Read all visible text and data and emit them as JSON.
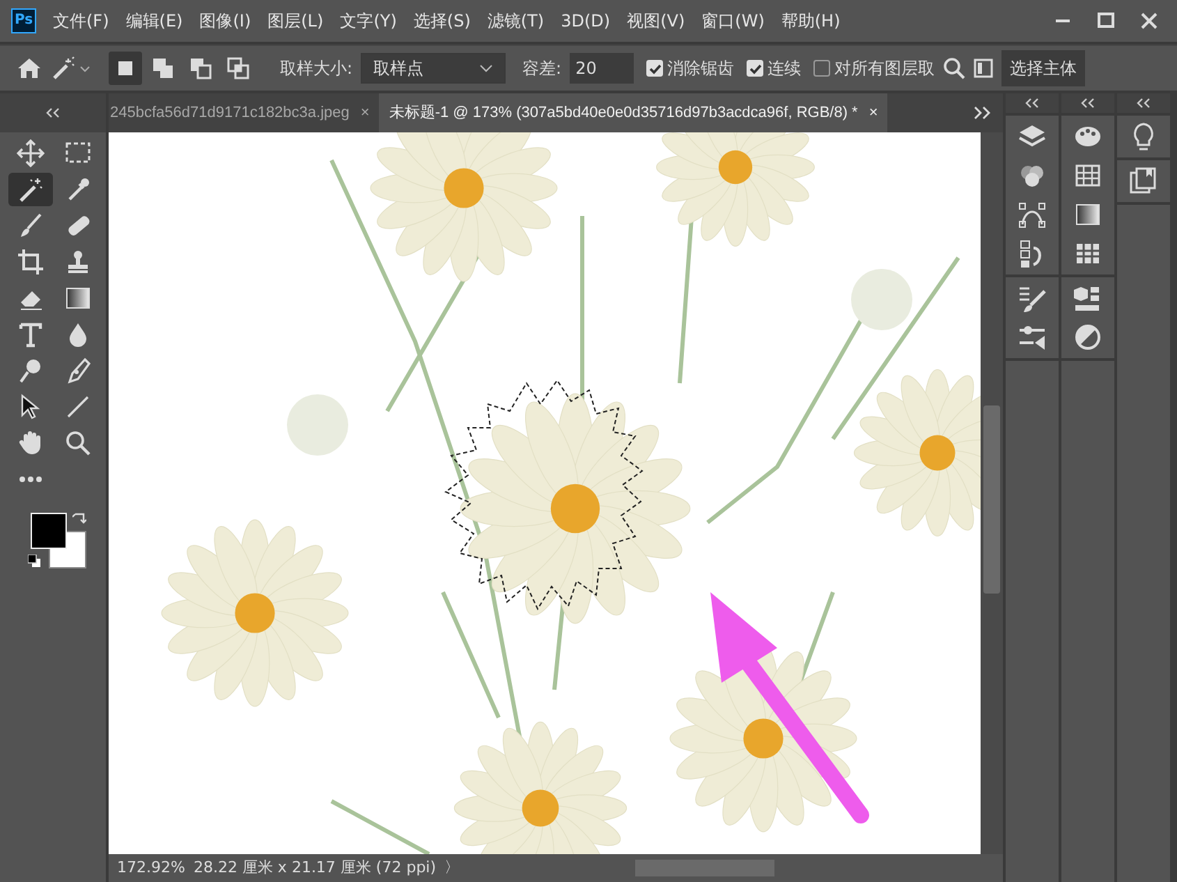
{
  "app_icon": "Ps",
  "menu": [
    "文件(F)",
    "编辑(E)",
    "图像(I)",
    "图层(L)",
    "文字(Y)",
    "选择(S)",
    "滤镜(T)",
    "3D(D)",
    "视图(V)",
    "窗口(W)",
    "帮助(H)"
  ],
  "options_bar": {
    "modes": [
      {
        "kind": "new",
        "selected": true
      },
      {
        "kind": "add",
        "selected": false
      },
      {
        "kind": "subtract",
        "selected": false
      },
      {
        "kind": "intersect",
        "selected": false
      }
    ],
    "sample_size_label": "取样大小:",
    "sample_size_value": "取样点",
    "tolerance_label": "容差:",
    "tolerance_value": "20",
    "checkboxes": [
      {
        "label": "消除锯齿",
        "checked": true
      },
      {
        "label": "连续",
        "checked": true
      },
      {
        "label": "对所有图层取",
        "checked": false
      }
    ],
    "select_subject_button": "选择主体"
  },
  "tabs": [
    {
      "label": "245bcfa56d71d9171c182bc3a.jpeg",
      "close": "×",
      "selected": false
    },
    {
      "label": "未标题-1 @ 173% (307a5bd40e0e0d35716d97b3acdca96f, RGB/8) *",
      "close": "×",
      "selected": true
    }
  ],
  "tools": [
    {
      "kind": "move",
      "selected": false
    },
    {
      "kind": "marquee",
      "selected": false
    },
    {
      "kind": "wand",
      "selected": true
    },
    {
      "kind": "eyedropper",
      "selected": false
    },
    {
      "kind": "brush",
      "selected": false
    },
    {
      "kind": "bandage",
      "selected": false
    },
    {
      "kind": "crop",
      "selected": false
    },
    {
      "kind": "stamp",
      "selected": false
    },
    {
      "kind": "eraser",
      "selected": false
    },
    {
      "kind": "gradient",
      "selected": false
    },
    {
      "kind": "type",
      "selected": false
    },
    {
      "kind": "drop",
      "selected": false
    },
    {
      "kind": "dodge",
      "selected": false
    },
    {
      "kind": "pen",
      "selected": false
    },
    {
      "kind": "pointer",
      "selected": false
    },
    {
      "kind": "line",
      "selected": false
    },
    {
      "kind": "hand",
      "selected": false
    },
    {
      "kind": "zoom",
      "selected": false
    },
    {
      "kind": "more",
      "selected": false
    }
  ],
  "status_bar": {
    "zoom": "172.92%",
    "document_size": "28.22 厘米 x 21.17 厘米 (72 ppi)",
    "menu_arrow": "〉"
  },
  "panels": [
    {
      "groups": [
        [
          {
            "kind": "layers"
          },
          {
            "kind": "channels"
          },
          {
            "kind": "paths"
          },
          {
            "kind": "history"
          }
        ],
        [
          {
            "kind": "brushes"
          },
          {
            "kind": "properties"
          }
        ]
      ]
    },
    {
      "groups": [
        [
          {
            "kind": "palette"
          },
          {
            "kind": "swatches"
          },
          {
            "kind": "gradients"
          },
          {
            "kind": "patterns"
          }
        ],
        [
          {
            "kind": "libraries"
          },
          {
            "kind": "adjustments"
          }
        ]
      ]
    },
    {
      "groups": [
        [
          {
            "kind": "learn"
          }
        ],
        [
          {
            "kind": "comments"
          }
        ]
      ]
    }
  ]
}
